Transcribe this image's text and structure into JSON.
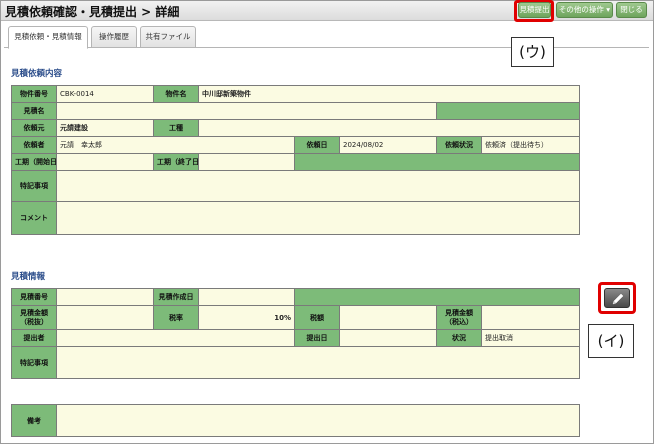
{
  "header": {
    "title": "見積依頼確認・見積提出 > 詳細",
    "buttons": {
      "submit_quote": "見積提出",
      "other_actions": "その他の操作 ▾",
      "close": "閉じる"
    }
  },
  "tabs": [
    "見積依頼・見積情報",
    "操作履歴",
    "共有ファイル"
  ],
  "annotations": {
    "u": "(ウ)",
    "i": "(イ)"
  },
  "request": {
    "section_title": "見積依頼内容",
    "labels": {
      "property_no": "物件番号",
      "property_name": "物件名",
      "quote_name": "見積名",
      "requester": "依頼元",
      "work_type": "工種",
      "requester_person": "依頼者",
      "request_date": "依頼日",
      "request_status": "依頼状況",
      "period_start": "工期（開始日）",
      "period_end": "工期（終了日）",
      "special_notes": "特記事項",
      "comment": "コメント"
    },
    "values": {
      "property_no": "CBK-0014",
      "property_name": "中川邸新築物件",
      "quote_name": "",
      "requester": "元請建設",
      "work_type": "",
      "requester_person": "元請　幸太郎",
      "request_date": "2024/08/02",
      "request_status": "依頼済（提出待ち）",
      "period_start": "",
      "period_end": "",
      "special_notes": "",
      "comment": ""
    }
  },
  "quote": {
    "section_title": "見積情報",
    "labels": {
      "quote_no": "見積番号",
      "created_date": "見積作成日",
      "amount_excl": "見積金額\n（税抜）",
      "tax_rate": "税率",
      "tax_amount": "税額",
      "amount_incl": "見積金額\n（税込）",
      "submitter": "提出者",
      "submit_date": "提出日",
      "status": "状況",
      "special_notes": "特記事項"
    },
    "values": {
      "quote_no": "",
      "created_date": "",
      "amount_excl": "",
      "tax_rate": "10%",
      "tax_amount": "",
      "amount_incl": "",
      "submitter": "",
      "submit_date": "",
      "status": "提出取消",
      "special_notes": ""
    }
  },
  "remarks": {
    "label": "備考",
    "value": ""
  },
  "icons": {
    "edit": "pencil-icon"
  },
  "colors": {
    "label_green": "#7dbb79",
    "value_cream": "#fbfbe2",
    "highlight_red": "#e00000",
    "section_blue": "#2a4c8a"
  }
}
